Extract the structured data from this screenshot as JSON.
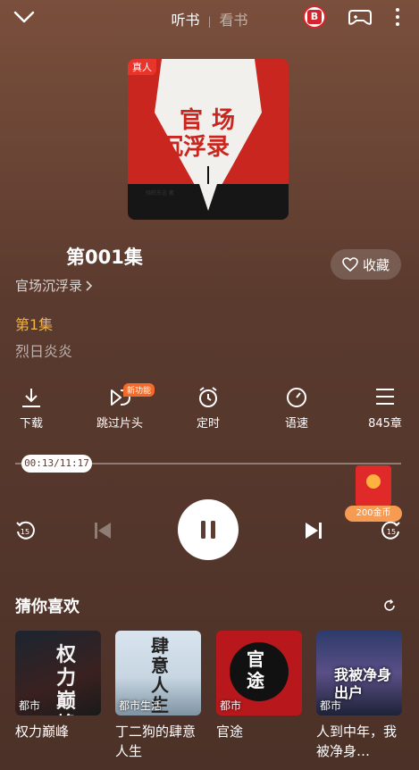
{
  "header": {
    "tab_listen": "听书",
    "tab_read": "看书"
  },
  "cover": {
    "tag": "真人",
    "title_line1": "官场",
    "title_line2": "沉浮录",
    "author_small": "骑鹤东巡 著"
  },
  "episode": {
    "title": "第001集",
    "book_link": "官场沉浮录",
    "favorite_label": "收藏",
    "number": "第1集",
    "narrator": "烈日炎炎"
  },
  "controls": {
    "download": "下载",
    "skip_intro": "跳过片头",
    "new_feature_tag": "新功能",
    "timer": "定时",
    "speed": "语速",
    "chapters": "845章"
  },
  "progress": {
    "time": "00:13/11:17",
    "fraction": 0.019
  },
  "reward": {
    "coins": "200金币"
  },
  "recommend": {
    "title": "猜你喜欢",
    "items": [
      {
        "category": "都市",
        "name": "权力巅峰",
        "cover_text": "权力巅峰"
      },
      {
        "category": "都市生活",
        "name": "丁二狗的肆意人生",
        "cover_text": "肆意人生"
      },
      {
        "category": "都市",
        "name": "官途",
        "cover_text": "官途"
      },
      {
        "category": "都市",
        "name": "人到中年，我被净身…",
        "cover_text": "我被净身出户"
      }
    ]
  },
  "colors": {
    "accent_orange": "#f0b34a",
    "brand_red": "#d3252b"
  }
}
